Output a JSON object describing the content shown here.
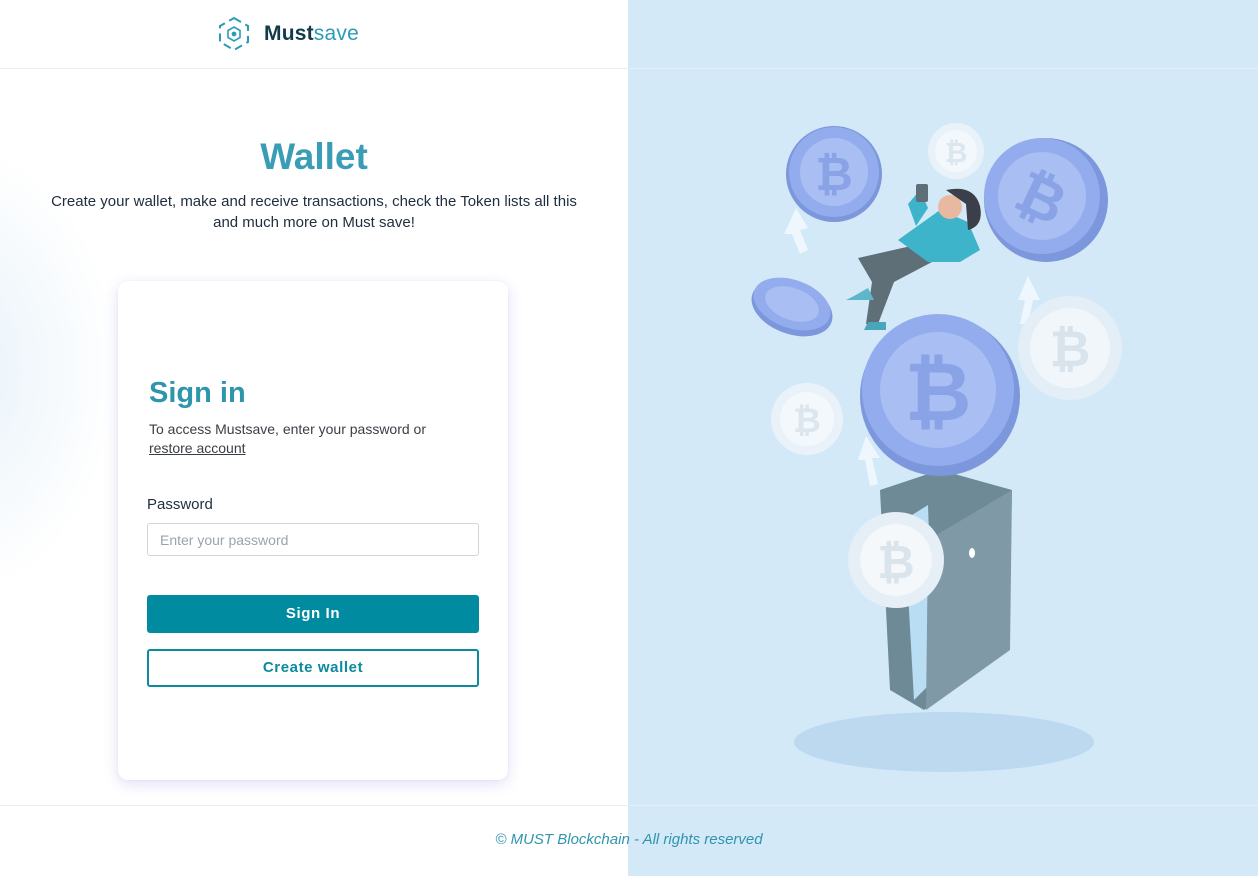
{
  "brand": {
    "name_part1": "Must",
    "name_part2": "save",
    "logo_icon": "hexagon-logo-icon",
    "accent_color": "#2b9cb5"
  },
  "hero": {
    "title": "Wallet",
    "subtitle": "Create your wallet, make and receive transactions, check the Token lists all this and much more on Must save!"
  },
  "signin": {
    "title": "Sign in",
    "description": "To access Mustsave, enter your password or",
    "restore_link": "restore account",
    "password_label": "Password",
    "password_placeholder": "Enter your password",
    "password_value": "",
    "signin_button": "Sign In",
    "create_wallet_button": "Create wallet",
    "primary_color": "#008ba0"
  },
  "illustration": {
    "icon": "crypto-wallet-illustration",
    "background_color": "#d3e9f8",
    "coin_color": "#8fa9ea"
  },
  "footer": {
    "copyright": "© MUST Blockchain - All rights reserved"
  }
}
